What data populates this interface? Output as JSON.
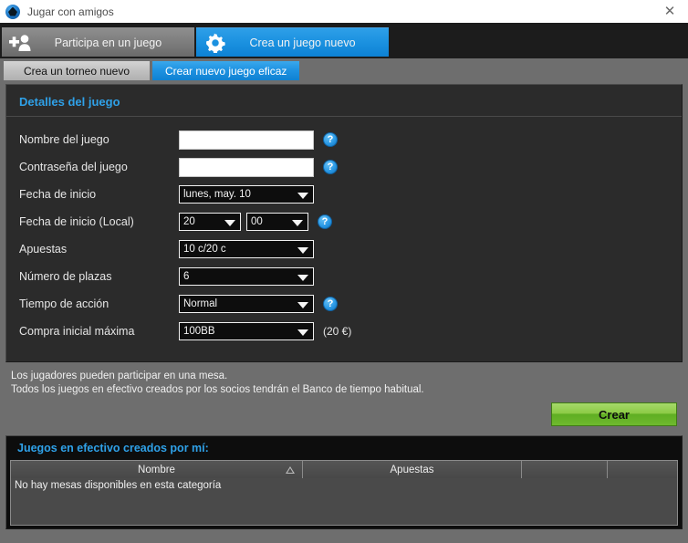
{
  "window": {
    "title": "Jugar con amigos",
    "app_icon": "poker-chip-icon",
    "close_label": "✕"
  },
  "primary_tabs": [
    {
      "label": "Participa en un juego",
      "icon": "add-player-icon",
      "active": false
    },
    {
      "label": "Crea un juego nuevo",
      "icon": "gear-icon",
      "active": true
    }
  ],
  "secondary_tabs": [
    {
      "label": "Crea un torneo nuevo",
      "active": false
    },
    {
      "label": "Crear nuevo juego eficaz",
      "active": true
    }
  ],
  "details": {
    "section_title": "Detalles del juego",
    "fields": {
      "game_name": {
        "label": "Nombre del juego",
        "value": "",
        "placeholder": "",
        "help": "?"
      },
      "game_password": {
        "label": "Contraseña del juego",
        "value": "",
        "placeholder": "",
        "help": "?"
      },
      "start_date": {
        "label": "Fecha de inicio",
        "value": "lunes, may. 10"
      },
      "start_time": {
        "label": "Fecha de inicio (Local)",
        "hour": "20",
        "minute": "00",
        "help": "?"
      },
      "stakes": {
        "label": "Apuestas",
        "value": "10 c/20 c"
      },
      "seats": {
        "label": "Número de plazas",
        "value": "6"
      },
      "action_time": {
        "label": "Tiempo de acción",
        "value": "Normal",
        "help": "?"
      },
      "max_buyin": {
        "label": "Compra inicial máxima",
        "value": "100BB",
        "suffix": "(20 €)"
      }
    }
  },
  "notes": {
    "line1": "Los jugadores pueden participar en una mesa.",
    "line2": "Todos los juegos en efectivo creados por los socios tendrán el Banco de tiempo habitual."
  },
  "actions": {
    "create_label": "Crear"
  },
  "my_games": {
    "title": "Juegos en efectivo creados por mí:",
    "columns": [
      "Nombre",
      "Apuestas",
      "",
      ""
    ],
    "sort_column": "Nombre",
    "sort_direction": "asc",
    "rows": [],
    "empty_message": "No hay mesas disponibles en esta categoría"
  },
  "colors": {
    "accent_blue": "#2fa1e8",
    "tab_blue": "#1b91e0",
    "create_green": "#8ccb46",
    "panel_dark": "#2b2b2b",
    "window_grey": "#6e6e6e"
  }
}
